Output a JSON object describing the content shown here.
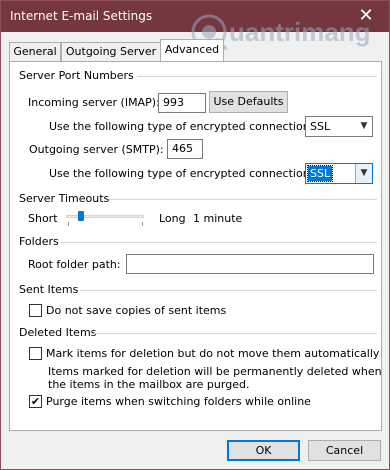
{
  "window": {
    "title": "Internet E-mail Settings",
    "close_glyph": "✕"
  },
  "tabs": [
    {
      "label": "General",
      "active": false
    },
    {
      "label": "Outgoing Server",
      "active": false
    },
    {
      "label": "Advanced",
      "active": true
    }
  ],
  "server_ports": {
    "group_label": "Server Port Numbers",
    "incoming_label": "Incoming server (IMAP):",
    "incoming_value": "993",
    "use_defaults_label": "Use Defaults",
    "incoming_encryption_label": "Use the following type of encrypted connection:",
    "incoming_encryption_value": "SSL",
    "outgoing_label": "Outgoing server (SMTP):",
    "outgoing_value": "465",
    "outgoing_encryption_label": "Use the following type of encrypted connection:",
    "outgoing_encryption_value": "SSL"
  },
  "server_timeouts": {
    "group_label": "Server Timeouts",
    "short_label": "Short",
    "long_label": "Long",
    "value_text": "1 minute",
    "slider_level": 0.17
  },
  "folders": {
    "group_label": "Folders",
    "root_folder_label": "Root folder path:",
    "root_folder_value": ""
  },
  "sent_items": {
    "group_label": "Sent Items",
    "no_save_label": "Do not save copies of sent items",
    "no_save_checked": false
  },
  "deleted_items": {
    "group_label": "Deleted Items",
    "mark_label": "Mark items for deletion but do not move them automatically",
    "mark_checked": false,
    "note_line1": "Items marked for deletion will be permanently deleted when",
    "note_line2": "the items in the mailbox are purged.",
    "purge_label": "Purge items when switching folders while online",
    "purge_checked": true,
    "check_glyph": "✔"
  },
  "footer": {
    "ok_label": "OK",
    "cancel_label": "Cancel"
  },
  "watermark": {
    "text": "uantrimang"
  },
  "colors": {
    "titlebar": "#74363f",
    "accent": "#0078d7",
    "watermark": "#9aa9bd"
  }
}
